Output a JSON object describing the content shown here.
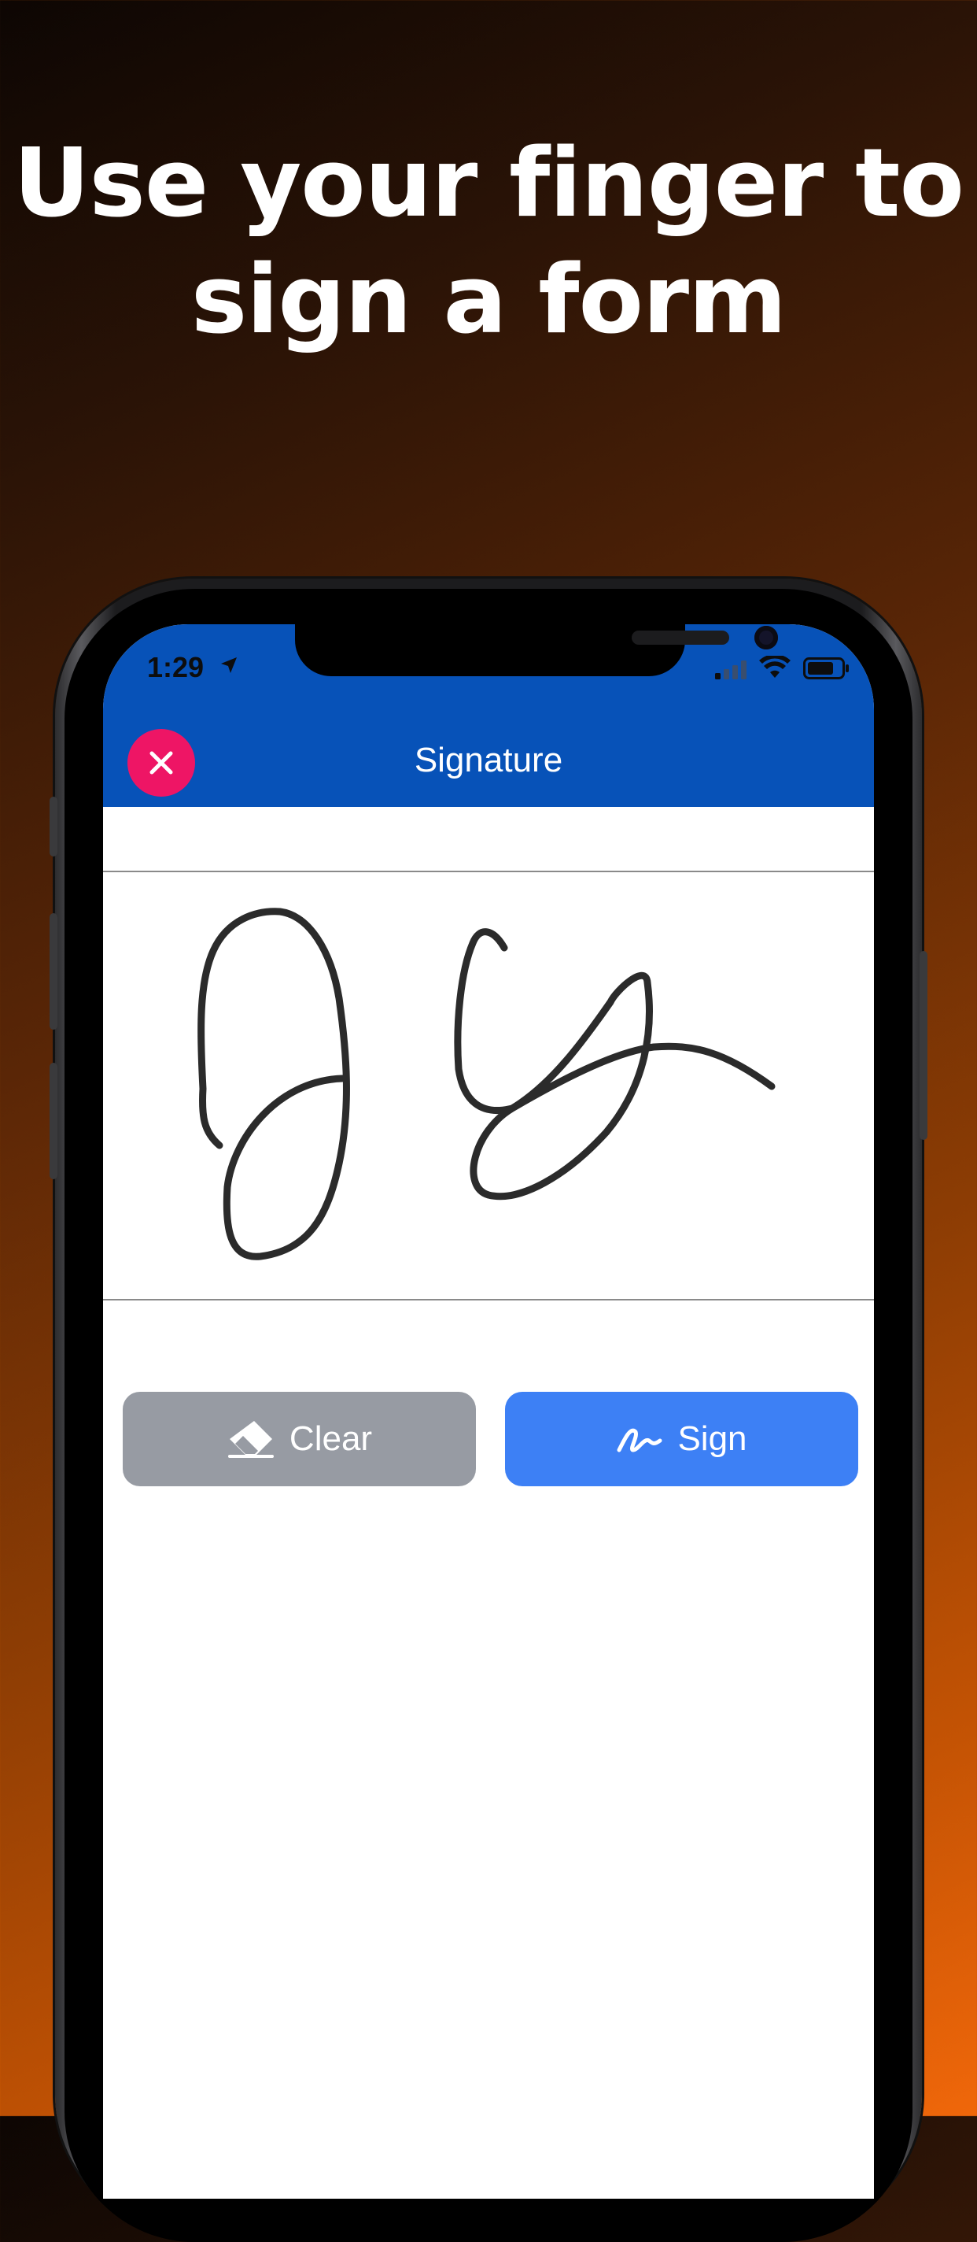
{
  "headline": {
    "line1": "Use your finger to",
    "line2": "sign a form"
  },
  "status_bar": {
    "time": "1:29"
  },
  "header": {
    "title": "Signature",
    "close_icon": "close-icon"
  },
  "actions": {
    "clear_label": "Clear",
    "clear_icon": "eraser-icon",
    "sign_label": "Sign",
    "sign_icon": "signature-icon"
  },
  "colors": {
    "appbar": "#0752b8",
    "close": "#ee1565",
    "clear_button": "#979ba3",
    "sign_button": "#3d80f5",
    "ink": "#2b2b2b"
  }
}
